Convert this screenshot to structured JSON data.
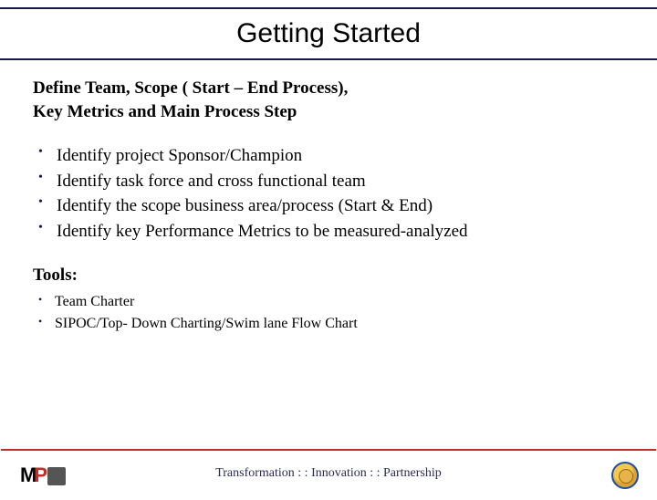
{
  "title": "Getting Started",
  "subhead_line1": "Define Team, Scope ( Start – End Process),",
  "subhead_line2": "Key Metrics and Main Process Step",
  "points": [
    "Identify project Sponsor/Champion",
    "Identify task force and cross functional team",
    "Identify the scope business area/process (Start & End)",
    "Identify key Performance Metrics to be measured-analyzed"
  ],
  "tools_label": "Tools:",
  "tools": [
    "Team Charter",
    "SIPOC/Top- Down Charting/Swim lane Flow Chart"
  ],
  "footer_text": "Transformation : : Innovation : : Partnership",
  "logo": {
    "m": "M",
    "p": "P"
  }
}
